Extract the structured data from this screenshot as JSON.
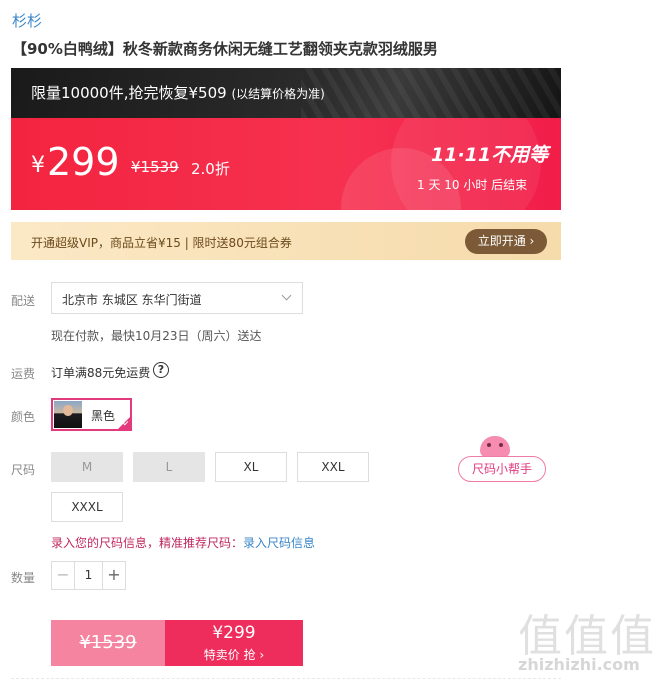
{
  "brand": "杉杉",
  "product_title": "【90%白鸭绒】秋冬新款商务休闲无缝工艺翻领夹克款羽绒服男",
  "promo": {
    "headline": "限量10000件,抢完恢复¥509",
    "note": "(以结算价格为准)"
  },
  "price": {
    "currency": "¥",
    "current": "299",
    "original": "¥1539",
    "discount": "2.0折",
    "event": "11·11不用等",
    "countdown": "1  天  10  小时  后结束"
  },
  "vip": {
    "text": "开通超级VIP，商品立省¥15 | 限时送80元组合券",
    "button": "立即开通 ›"
  },
  "delivery": {
    "label": "配送",
    "address": "北京市 东城区 东华门街道",
    "eta": "现在付款，最快10月23日（周六）送达"
  },
  "freight": {
    "label": "运费",
    "text": "订单满88元免运费",
    "help": "?"
  },
  "color": {
    "label": "颜色",
    "option": "黑色"
  },
  "size": {
    "label": "尺码",
    "options": [
      "M",
      "L",
      "XL",
      "XXL",
      "XXXL"
    ],
    "helper": "尺码小帮手",
    "tip": "录入您的尺码信息，精准推荐尺码：",
    "tip_link": "录入尺码信息"
  },
  "quantity": {
    "label": "数量",
    "minus": "−",
    "value": "1",
    "plus": "+"
  },
  "buy": {
    "original": "¥1539",
    "sale_price": "¥299",
    "sale_cta": "特卖价 抢 ›"
  },
  "watermark": {
    "glyphs": "值值值",
    "site": "zhizhizhi.com"
  }
}
